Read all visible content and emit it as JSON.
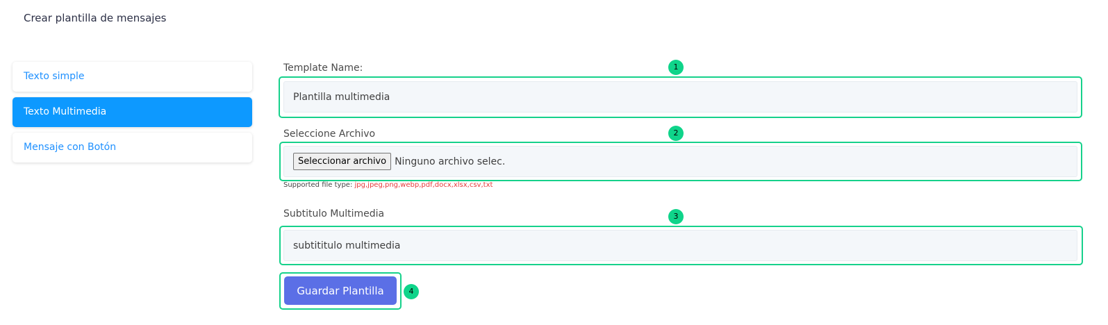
{
  "page_title": "Crear plantilla de mensajes",
  "menu": {
    "items": [
      {
        "label": "Texto simple",
        "active": false
      },
      {
        "label": "Texto Multimedia",
        "active": true
      },
      {
        "label": "Mensaje con Botón",
        "active": false
      }
    ]
  },
  "form": {
    "template_name": {
      "label": "Template Name:",
      "value": "Plantilla multimedia"
    },
    "file": {
      "label": "Seleccione Archivo",
      "button_label": "Seleccionar archivo",
      "status": "Ninguno archivo selec.",
      "supported_prefix": "Supported file type:",
      "supported_types": "jpg,jpeg,png,webp,pdf,docx,xlsx,csv,txt"
    },
    "subtitle": {
      "label": "Subtitulo Multimedia",
      "value": "subtititulo multimedia"
    },
    "save_label": "Guardar Plantilla"
  },
  "badges": [
    "1",
    "2",
    "3",
    "4"
  ],
  "colors": {
    "accent_blue": "#0d99ff",
    "highlight_green": "#16d18b",
    "save_button": "#5b6fe6",
    "supported_types": "#e63939"
  }
}
